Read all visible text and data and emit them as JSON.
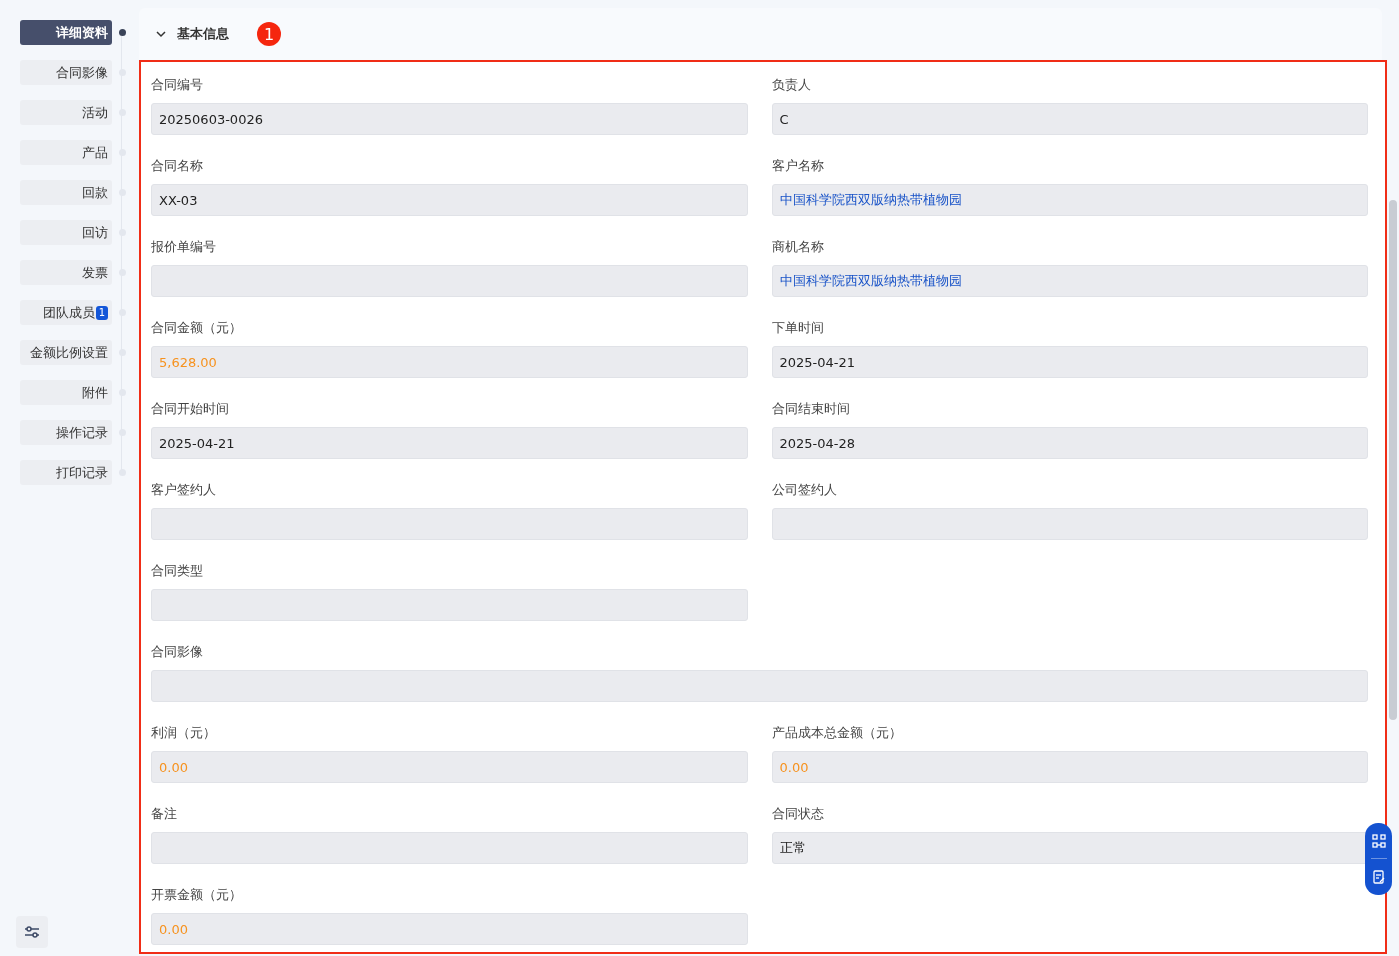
{
  "nav": {
    "items": [
      {
        "label": "详细资料",
        "selected": true
      },
      {
        "label": "合同影像",
        "selected": false
      },
      {
        "label": "活动",
        "selected": false
      },
      {
        "label": "产品",
        "selected": false
      },
      {
        "label": "回款",
        "selected": false
      },
      {
        "label": "回访",
        "selected": false
      },
      {
        "label": "发票",
        "selected": false
      },
      {
        "label": "团队成员",
        "selected": false,
        "badge": "1"
      },
      {
        "label": "金额比例设置",
        "selected": false
      },
      {
        "label": "附件",
        "selected": false
      },
      {
        "label": "操作记录",
        "selected": false
      },
      {
        "label": "打印记录",
        "selected": false
      }
    ]
  },
  "section": {
    "title": "基本信息",
    "expanded": true,
    "step_badge": "1",
    "rows": [
      {
        "kind": "pair",
        "fields": [
          {
            "label": "合同编号",
            "value": "20250603-0026",
            "kind": "plain"
          },
          {
            "label": "负责人",
            "value": "C",
            "kind": "plain"
          }
        ]
      },
      {
        "kind": "pair",
        "fields": [
          {
            "label": "合同名称",
            "value": "XX-03",
            "kind": "plain"
          },
          {
            "label": "客户名称",
            "value": "中国科学院西双版纳热带植物园",
            "kind": "link"
          }
        ]
      },
      {
        "kind": "pair",
        "fields": [
          {
            "label": "报价单编号"
          },
          {
            "label": "商机名称",
            "value": "中国科学院西双版纳热带植物园",
            "kind": "link"
          }
        ]
      },
      {
        "kind": "pair",
        "fields": [
          {
            "label": "合同金额（元）",
            "value": "5,628.00",
            "kind": "amount"
          },
          {
            "label": "下单时间",
            "value": "2025-04-21",
            "kind": "plain"
          }
        ]
      },
      {
        "kind": "pair",
        "fields": [
          {
            "label": "合同开始时间",
            "value": "2025-04-21",
            "kind": "plain"
          },
          {
            "label": "合同结束时间",
            "value": "2025-04-28",
            "kind": "plain"
          }
        ]
      },
      {
        "kind": "pair",
        "fields": [
          {
            "label": "客户签约人"
          },
          {
            "label": "公司签约人"
          }
        ]
      },
      {
        "kind": "pair",
        "fields": [
          {
            "label": "合同类型"
          }
        ]
      },
      {
        "kind": "wide",
        "fields": [
          {
            "label": "合同影像"
          }
        ]
      },
      {
        "kind": "pair",
        "fields": [
          {
            "label": "利润（元）",
            "value": "0.00",
            "kind": "amount"
          },
          {
            "label": "产品成本总金额（元）",
            "value": "0.00",
            "kind": "amount"
          }
        ]
      },
      {
        "kind": "pair",
        "fields": [
          {
            "label": "备注"
          },
          {
            "label": "合同状态",
            "value": "正常",
            "kind": "plain"
          }
        ]
      },
      {
        "kind": "pair",
        "fields": [
          {
            "label": "开票金额（元）",
            "value": "0.00",
            "kind": "amount"
          }
        ]
      }
    ]
  }
}
